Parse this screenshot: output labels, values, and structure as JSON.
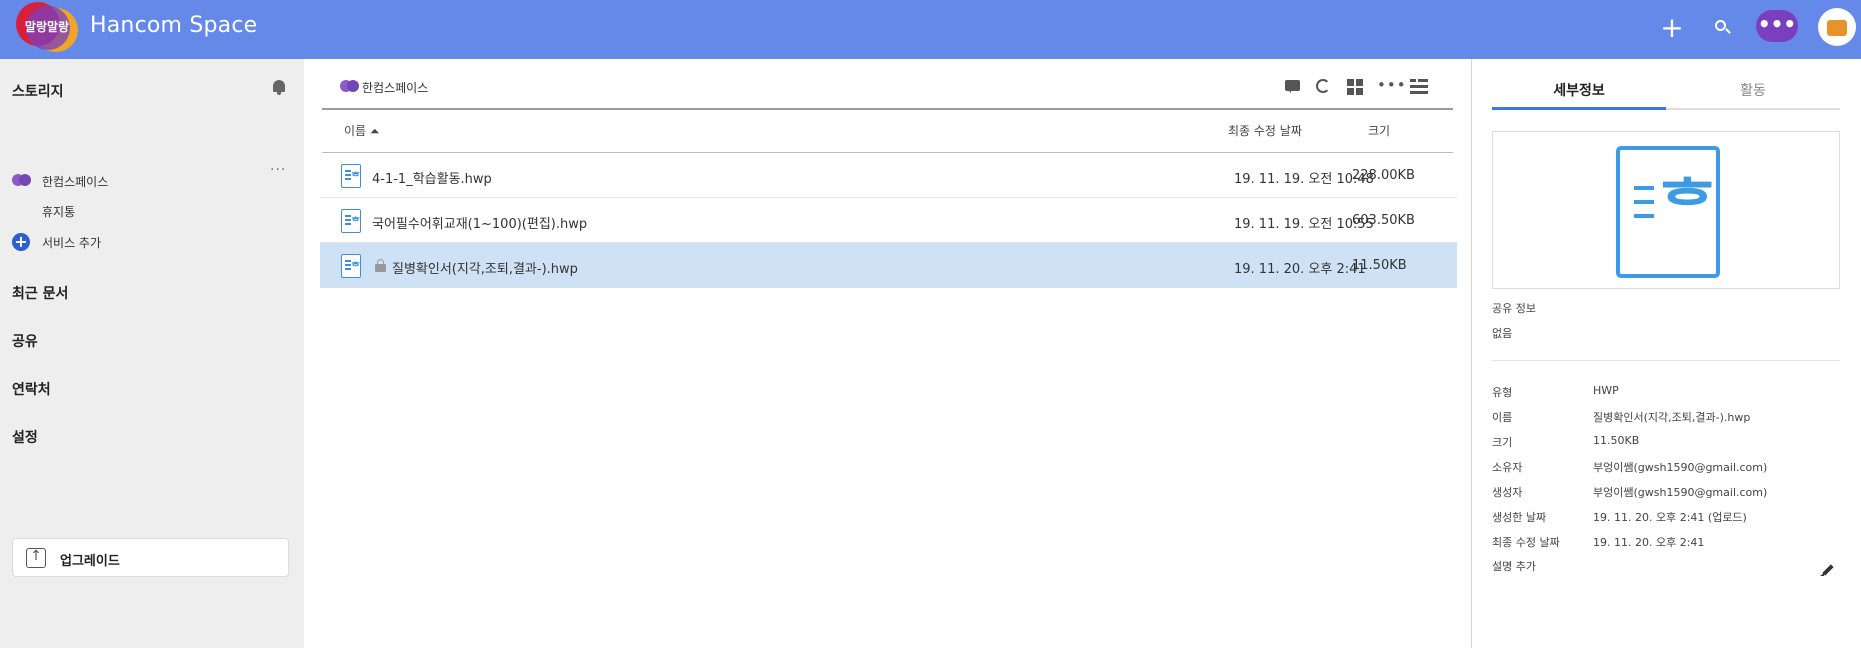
{
  "app": {
    "title": "Hancom Space",
    "logo_text": "말랑말랑",
    "actions": {
      "add": "+",
      "more": "•••"
    }
  },
  "sidebar": {
    "storage_heading": "스토리지",
    "space_name": "한컴스페이스",
    "space_more": "···",
    "trash": "휴지통",
    "add_service": "서비스 추가",
    "add_service_glyph": "+",
    "recent_docs": "최근 문서",
    "share": "공유",
    "contacts": "연락처",
    "settings": "설정",
    "upgrade": "업그레이드",
    "upgrade_glyph": "↑"
  },
  "main": {
    "breadcrumb": "한컴스페이스",
    "toolbar_more": "•••",
    "columns": {
      "name": "이름 ⏶",
      "modified": "최종 수정 날짜",
      "size": "크기"
    },
    "files": [
      {
        "name": "4-1-1_학습활동.hwp",
        "modified": "19. 11. 19. 오전 10:48",
        "size": "228.00KB",
        "locked": false,
        "selected": false
      },
      {
        "name": "국어필수어휘교재(1~100)(편집).hwp",
        "modified": "19. 11. 19. 오전 10:55",
        "size": "603.50KB",
        "locked": false,
        "selected": false
      },
      {
        "name": "질병확인서(지각,조퇴,결과-).hwp",
        "modified": "19. 11. 20. 오후 2:41",
        "size": "11.50KB",
        "locked": true,
        "selected": true
      }
    ],
    "file_glyph": "ᄒ"
  },
  "detail": {
    "tab_details": "세부정보",
    "tab_activity": "활동",
    "preview_glyph": "ᄒ",
    "share_info_label": "공유 정보",
    "share_info_value": "없음",
    "type_label": "유형",
    "type_value": "HWP",
    "name_label": "이름",
    "name_value": "질병확인서(지각,조퇴,결과-).hwp",
    "size_label": "크기",
    "size_value": "11.50KB",
    "owner_label": "소유자",
    "owner_value": "부엉이쌤(gwsh1590@gmail.com)",
    "creator_label": "생성자",
    "creator_value": "부엉이쌤(gwsh1590@gmail.com)",
    "created_label": "생성한 날짜",
    "created_value": "19. 11. 20. 오후 2:41 (업로드)",
    "modified_label": "최종 수정 날짜",
    "modified_value": "19. 11. 20. 오후 2:41",
    "add_desc_label": "설명 추가"
  },
  "colors": {
    "header_bg": "#6489e8",
    "sidebar_bg": "#eeeeee",
    "selected_row": "#cfe2f5",
    "accent_blue": "#3d78e8",
    "space_purple": "#7a3fbf",
    "file_icon_blue": "#3d9be6"
  }
}
